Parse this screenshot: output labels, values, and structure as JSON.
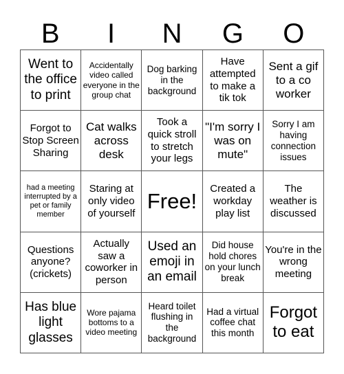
{
  "header": [
    "B",
    "I",
    "N",
    "G",
    "O"
  ],
  "cells": [
    "Went to the office to print",
    "Accidentally video called everyone in the group chat",
    "Dog barking in the background",
    "Have attempted to make a tik tok",
    "Sent a gif to a co worker",
    "Forgot to Stop Screen Sharing",
    "Cat walks across desk",
    "Took a quick stroll to stretch your legs",
    "\"I'm sorry I was on mute\"",
    "Sorry I am having connection issues",
    "had a meeting interrupted by a pet or family member",
    "Staring at only video of yourself",
    "Free!",
    "Created a workday play list",
    "The weather is discussed",
    "Questions anyone? (crickets)",
    "Actually saw a coworker in person",
    "Used an emoji in an email",
    "Did house hold chores on your lunch break",
    "You're in the wrong meeting",
    "Has blue light glasses",
    "Wore pajama bottoms to a video meeting",
    "Heard toilet flushing in the background",
    "Had a virtual coffee chat this month",
    "Forgot to eat"
  ]
}
